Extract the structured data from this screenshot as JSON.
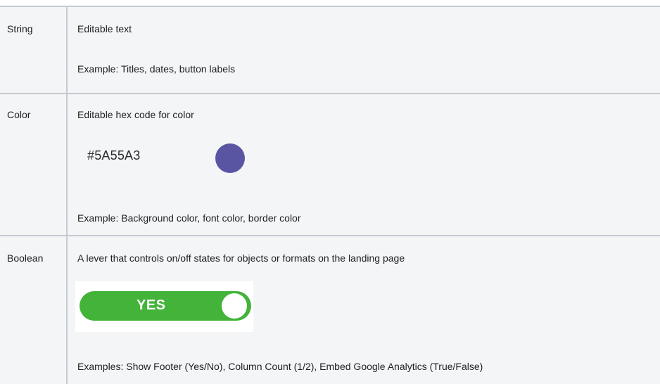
{
  "rows": [
    {
      "type": "String",
      "description": "Editable text",
      "example": "Example: Titles, dates, button labels"
    },
    {
      "type": "Color",
      "description": "Editable hex code for color",
      "sample_hex": "#5A55A3",
      "swatch_color": "#5A55A3",
      "example": "Example: Background color, font color, border color"
    },
    {
      "type": "Boolean",
      "description": "A lever that controls on/off states for objects or formats on the landing page",
      "toggle_label": "YES",
      "toggle_color": "#43B33A",
      "example": "Examples: Show Footer (Yes/No), Column Count (1/2), Embed Google Analytics (True/False)"
    }
  ]
}
